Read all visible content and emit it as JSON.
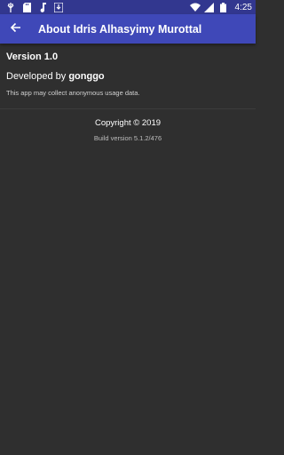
{
  "status_bar": {
    "time": "4:25",
    "icons": [
      "usb-icon",
      "sd-card-icon",
      "music-note-icon",
      "download-icon",
      "wifi-icon",
      "signal-icon",
      "battery-icon"
    ]
  },
  "app_bar": {
    "title": "About Idris Alhasyimy Murottal",
    "back_icon": "arrow-back-icon",
    "background_color": "#3f48b8",
    "status_color": "#32378f"
  },
  "about": {
    "version": "Version 1.0",
    "developed_prefix": "Developed by ",
    "developer": "gonggo",
    "analytics_notice": "This app may collect anonymous usage data.",
    "copyright": "Copyright © 2019",
    "build": "Build version 5.1.2/476"
  }
}
